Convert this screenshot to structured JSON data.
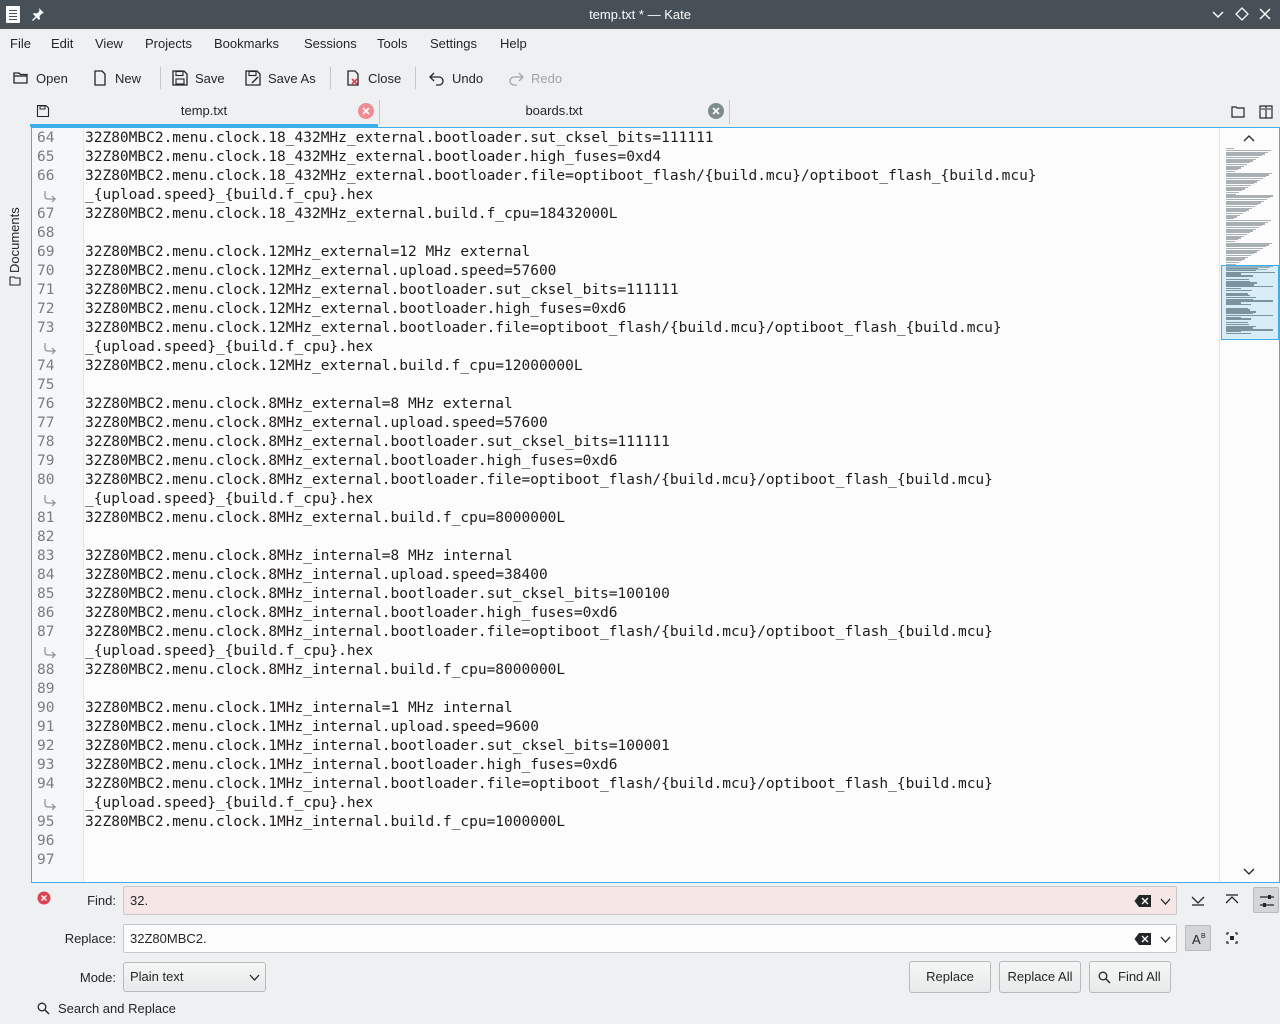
{
  "window": {
    "title": "temp.txt * — Kate"
  },
  "menubar": {
    "items": [
      "File",
      "Edit",
      "View",
      "Projects",
      "Bookmarks",
      "Sessions",
      "Tools",
      "Settings",
      "Help"
    ]
  },
  "toolbar": {
    "open": "Open",
    "new": "New",
    "save": "Save",
    "save_as": "Save As",
    "close": "Close",
    "undo": "Undo",
    "redo": "Redo"
  },
  "sidebar": {
    "documents_label": "Documents"
  },
  "tabs": [
    {
      "label": "temp.txt",
      "active": true
    },
    {
      "label": "boards.txt",
      "active": false
    }
  ],
  "editor": {
    "lines": [
      {
        "n": "64",
        "text": "32Z80MBC2.menu.clock.18_432MHz_external.bootloader.sut_cksel_bits=111111"
      },
      {
        "n": "65",
        "text": "32Z80MBC2.menu.clock.18_432MHz_external.bootloader.high_fuses=0xd4"
      },
      {
        "n": "66",
        "text": "32Z80MBC2.menu.clock.18_432MHz_external.bootloader.file=optiboot_flash/{build.mcu}/optiboot_flash_{build.mcu}"
      },
      {
        "n": "",
        "wrap": true,
        "text": "_{upload.speed}_{build.f_cpu}.hex"
      },
      {
        "n": "67",
        "text": "32Z80MBC2.menu.clock.18_432MHz_external.build.f_cpu=18432000L"
      },
      {
        "n": "68",
        "text": ""
      },
      {
        "n": "69",
        "text": "32Z80MBC2.menu.clock.12MHz_external=12 MHz external"
      },
      {
        "n": "70",
        "text": "32Z80MBC2.menu.clock.12MHz_external.upload.speed=57600"
      },
      {
        "n": "71",
        "text": "32Z80MBC2.menu.clock.12MHz_external.bootloader.sut_cksel_bits=111111"
      },
      {
        "n": "72",
        "text": "32Z80MBC2.menu.clock.12MHz_external.bootloader.high_fuses=0xd6"
      },
      {
        "n": "73",
        "text": "32Z80MBC2.menu.clock.12MHz_external.bootloader.file=optiboot_flash/{build.mcu}/optiboot_flash_{build.mcu}"
      },
      {
        "n": "",
        "wrap": true,
        "text": "_{upload.speed}_{build.f_cpu}.hex"
      },
      {
        "n": "74",
        "text": "32Z80MBC2.menu.clock.12MHz_external.build.f_cpu=12000000L"
      },
      {
        "n": "75",
        "text": ""
      },
      {
        "n": "76",
        "text": "32Z80MBC2.menu.clock.8MHz_external=8 MHz external"
      },
      {
        "n": "77",
        "text": "32Z80MBC2.menu.clock.8MHz_external.upload.speed=57600"
      },
      {
        "n": "78",
        "text": "32Z80MBC2.menu.clock.8MHz_external.bootloader.sut_cksel_bits=111111"
      },
      {
        "n": "79",
        "text": "32Z80MBC2.menu.clock.8MHz_external.bootloader.high_fuses=0xd6"
      },
      {
        "n": "80",
        "text": "32Z80MBC2.menu.clock.8MHz_external.bootloader.file=optiboot_flash/{build.mcu}/optiboot_flash_{build.mcu}"
      },
      {
        "n": "",
        "wrap": true,
        "text": "_{upload.speed}_{build.f_cpu}.hex"
      },
      {
        "n": "81",
        "text": "32Z80MBC2.menu.clock.8MHz_external.build.f_cpu=8000000L"
      },
      {
        "n": "82",
        "text": ""
      },
      {
        "n": "83",
        "text": "32Z80MBC2.menu.clock.8MHz_internal=8 MHz internal"
      },
      {
        "n": "84",
        "text": "32Z80MBC2.menu.clock.8MHz_internal.upload.speed=38400"
      },
      {
        "n": "85",
        "text": "32Z80MBC2.menu.clock.8MHz_internal.bootloader.sut_cksel_bits=100100"
      },
      {
        "n": "86",
        "text": "32Z80MBC2.menu.clock.8MHz_internal.bootloader.high_fuses=0xd6"
      },
      {
        "n": "87",
        "text": "32Z80MBC2.menu.clock.8MHz_internal.bootloader.file=optiboot_flash/{build.mcu}/optiboot_flash_{build.mcu}"
      },
      {
        "n": "",
        "wrap": true,
        "text": "_{upload.speed}_{build.f_cpu}.hex"
      },
      {
        "n": "88",
        "text": "32Z80MBC2.menu.clock.8MHz_internal.build.f_cpu=8000000L"
      },
      {
        "n": "89",
        "text": ""
      },
      {
        "n": "90",
        "text": "32Z80MBC2.menu.clock.1MHz_internal=1 MHz internal"
      },
      {
        "n": "91",
        "text": "32Z80MBC2.menu.clock.1MHz_internal.upload.speed=9600"
      },
      {
        "n": "92",
        "text": "32Z80MBC2.menu.clock.1MHz_internal.bootloader.sut_cksel_bits=100001"
      },
      {
        "n": "93",
        "text": "32Z80MBC2.menu.clock.1MHz_internal.bootloader.high_fuses=0xd6"
      },
      {
        "n": "94",
        "text": "32Z80MBC2.menu.clock.1MHz_internal.bootloader.file=optiboot_flash/{build.mcu}/optiboot_flash_{build.mcu}"
      },
      {
        "n": "",
        "wrap": true,
        "text": "_{upload.speed}_{build.f_cpu}.hex"
      },
      {
        "n": "95",
        "text": "32Z80MBC2.menu.clock.1MHz_internal.build.f_cpu=1000000L"
      },
      {
        "n": "96",
        "text": ""
      },
      {
        "n": "97",
        "text": ""
      }
    ]
  },
  "search": {
    "find_label": "Find:",
    "find_value": "32.",
    "replace_label": "Replace:",
    "replace_value": "32Z80MBC2.",
    "mode_label": "Mode:",
    "mode_value": "Plain text",
    "replace_button": "Replace",
    "replace_all_button": "Replace All",
    "find_all_button": "Find All",
    "status": "Search and Replace"
  },
  "colors": {
    "accent": "#3daee9",
    "titlebar": "#475057",
    "find_error_bg": "#f7e6e6",
    "error_icon": "#da4453"
  }
}
